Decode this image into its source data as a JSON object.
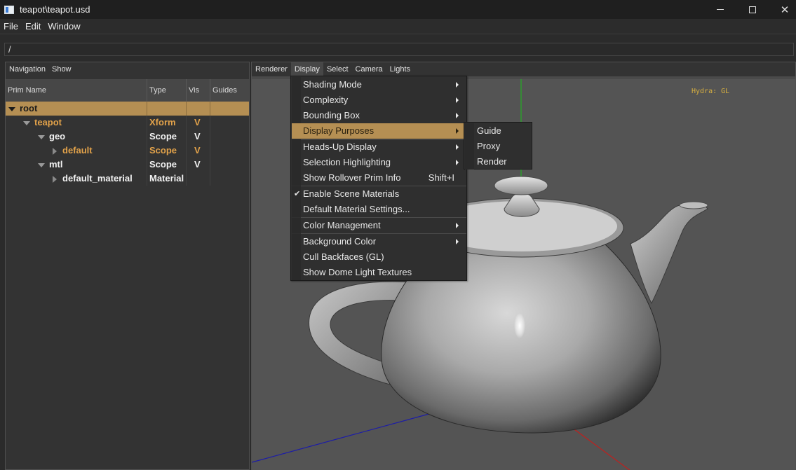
{
  "window": {
    "title": "teapot\\teapot.usd",
    "icon": "app-window-icon",
    "controls": [
      "minimize-icon",
      "maximize-icon",
      "close-icon"
    ],
    "close_glyph": "✕"
  },
  "menubar": {
    "items": [
      "File",
      "Edit",
      "Window"
    ]
  },
  "path": {
    "value": "/"
  },
  "left_panel": {
    "tabs": [
      "Navigation",
      "Show"
    ],
    "columns": [
      "Prim Name",
      "Type",
      "Vis",
      "Guides"
    ],
    "rows": [
      {
        "name": "root",
        "type": "",
        "vis": "",
        "expanded": true,
        "selected": true
      },
      {
        "name": "teapot",
        "type": "Xform",
        "vis": "V",
        "expanded": true,
        "color": "#e2a24a"
      },
      {
        "name": "geo",
        "type": "Scope",
        "vis": "V",
        "expanded": true,
        "color": "#f2f2f2"
      },
      {
        "name": "default",
        "type": "Scope",
        "vis": "V",
        "expanded": false,
        "color": "#e2a24a"
      },
      {
        "name": "mtl",
        "type": "Scope",
        "vis": "V",
        "expanded": true,
        "color": "#f2f2f2"
      },
      {
        "name": "default_material",
        "type": "Material",
        "vis": "",
        "expanded": false,
        "color": "#f2f2f2"
      }
    ]
  },
  "viewport": {
    "menu": [
      "Renderer",
      "Display",
      "Select",
      "Camera",
      "Lights"
    ],
    "active_menu": "Display",
    "hud_text": "Hydra: GL"
  },
  "display_menu": {
    "items": [
      {
        "label": "Shading Mode",
        "submenu": true
      },
      {
        "label": "Complexity",
        "submenu": true
      },
      {
        "label": "Bounding Box",
        "submenu": true
      },
      {
        "label": "Display Purposes",
        "submenu": true,
        "highlighted": true
      },
      {
        "label": "Heads-Up Display",
        "submenu": true
      },
      {
        "label": "Selection Highlighting",
        "submenu": true
      },
      {
        "label": "Show Rollover Prim Info",
        "shortcut": "Shift+I"
      },
      {
        "label": "Enable Scene Materials",
        "checked": true
      },
      {
        "label": "Default Material Settings..."
      },
      {
        "label": "Color Management",
        "submenu": true
      },
      {
        "label": "Background Color",
        "submenu": true
      },
      {
        "label": "Cull Backfaces (GL)"
      },
      {
        "label": "Show Dome Light Textures"
      }
    ],
    "check_glyph": "✔"
  },
  "purposes_submenu": {
    "items": [
      "Guide",
      "Proxy",
      "Render"
    ]
  },
  "colors": {
    "accent": "#b58f53",
    "orange_text": "#e2a24a",
    "hud": "#d8b040",
    "axis_x": "#c0201e",
    "axis_y": "#18c018",
    "axis_z": "#1c1ca8"
  }
}
